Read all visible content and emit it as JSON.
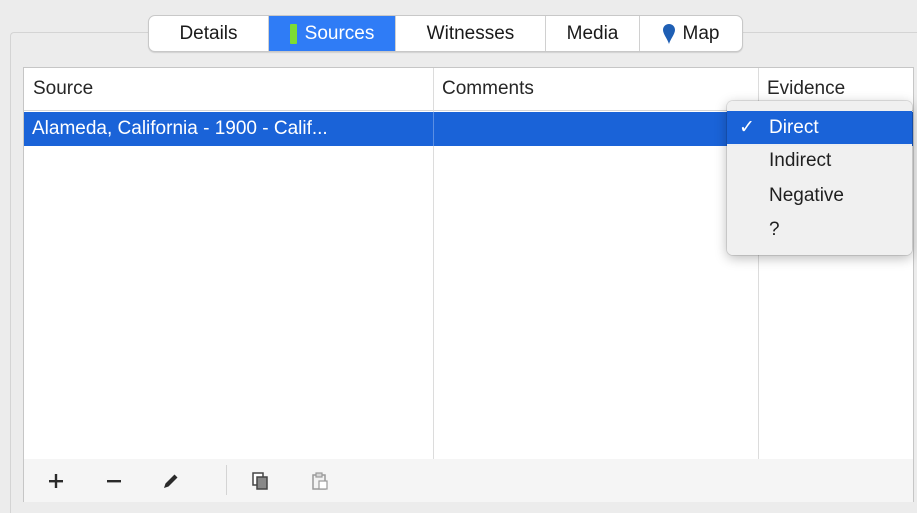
{
  "tabs": {
    "items": [
      {
        "label": "Details"
      },
      {
        "label": "Sources"
      },
      {
        "label": "Witnesses"
      },
      {
        "label": "Media"
      },
      {
        "label": "Map"
      }
    ],
    "selected": "Sources",
    "accent": "#2f7cf6"
  },
  "table": {
    "columns": [
      "Source",
      "Comments",
      "Evidence"
    ],
    "rows": [
      {
        "source": "Alameda, California - 1900 - Calif...",
        "comments": "",
        "evidence": "Direct",
        "selected": true
      }
    ],
    "selection_color": "#1a63d8"
  },
  "evidence_menu": {
    "checkmark": "✓",
    "items": [
      "Direct",
      "Indirect",
      "Negative",
      "?"
    ],
    "selected": "Direct"
  },
  "toolbar": {
    "buttons": [
      "add-icon",
      "remove-icon",
      "edit-pencil-icon",
      "copy-icon",
      "paste-icon"
    ],
    "add_glyph": "+",
    "remove_glyph": "−"
  }
}
